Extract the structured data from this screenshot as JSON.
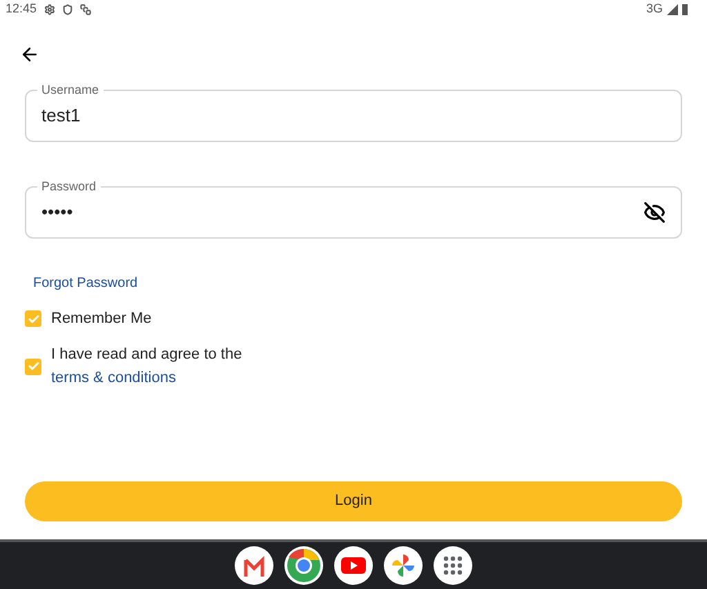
{
  "status_bar": {
    "time": "12:45",
    "network": "3G"
  },
  "form": {
    "username": {
      "label": "Username",
      "value": "test1"
    },
    "password": {
      "label": "Password",
      "value": "•••••"
    },
    "forgot_link": "Forgot Password",
    "checkboxes": [
      {
        "label": "Remember Me",
        "checked": true
      },
      {
        "label": "I have read and agree to the",
        "link": "terms & conditions",
        "checked": true
      }
    ],
    "login_button": "Login"
  },
  "taskbar": {
    "apps": [
      {
        "kind": "mail"
      },
      {
        "kind": "browser"
      },
      {
        "kind": "video"
      },
      {
        "kind": "photos"
      },
      {
        "kind": "apps"
      }
    ]
  }
}
